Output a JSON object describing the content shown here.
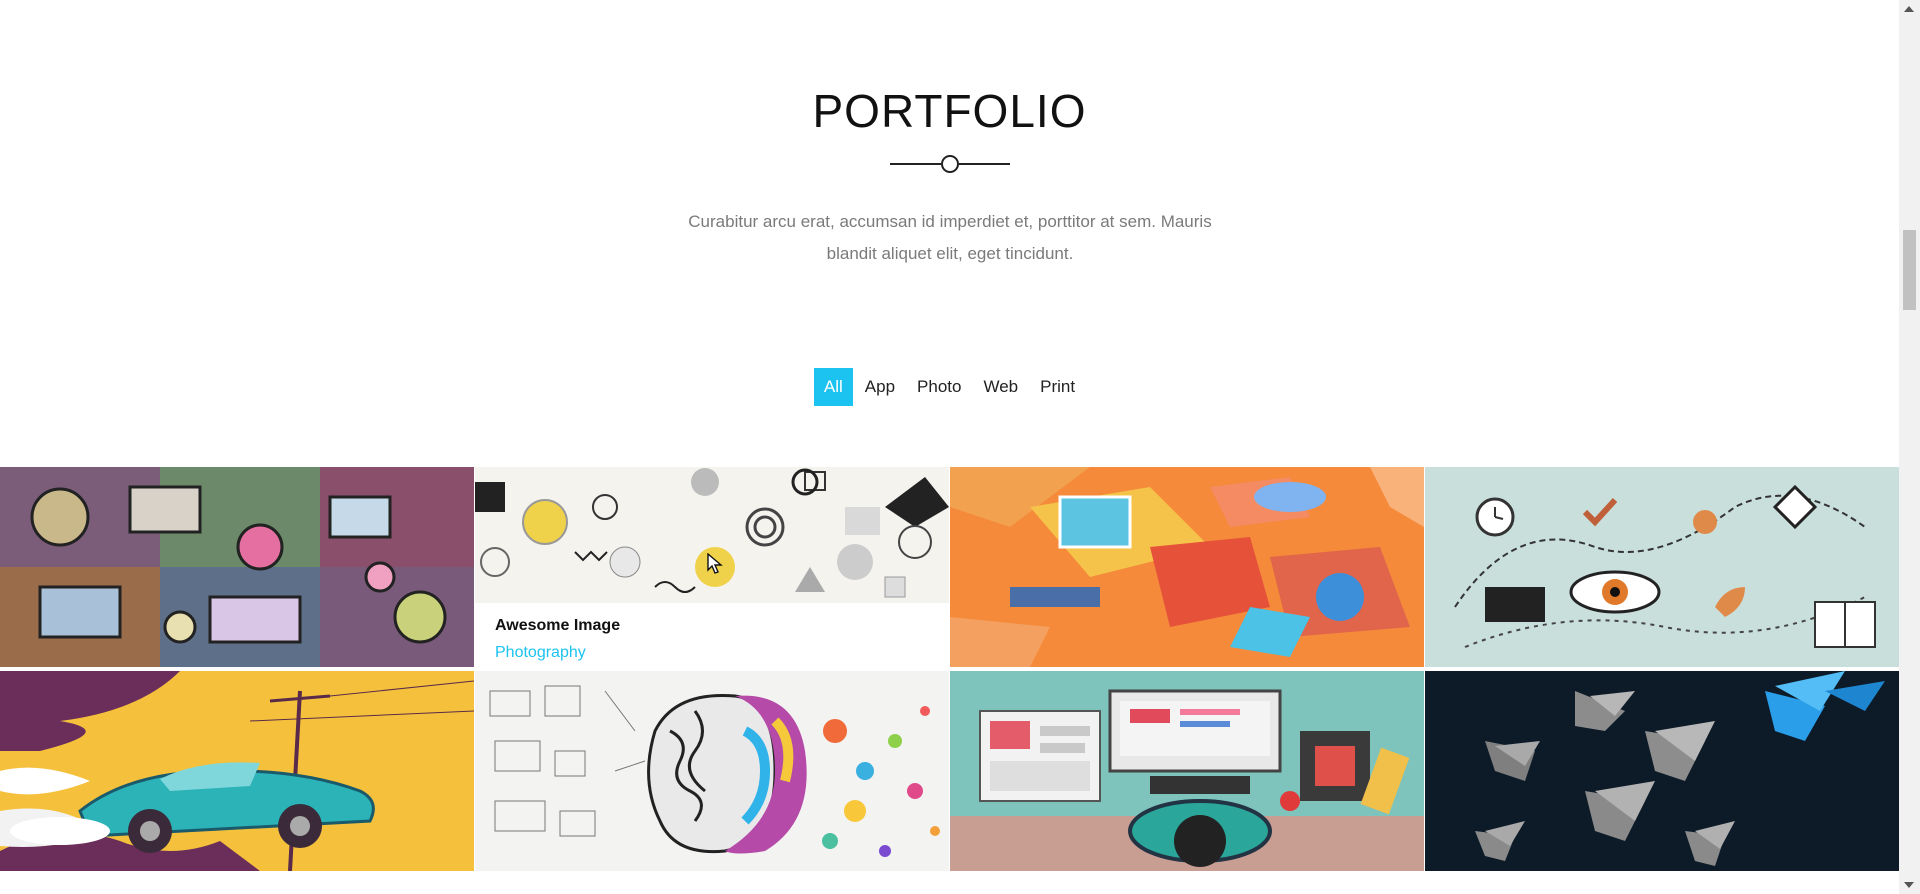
{
  "section": {
    "title": "PORTFOLIO",
    "subtitle": "Curabitur arcu erat, accumsan id imperdiet et, porttitor at sem. Mauris blandit aliquet elit, eget tincidunt."
  },
  "filters": [
    {
      "label": "All",
      "active": true
    },
    {
      "label": "App",
      "active": false
    },
    {
      "label": "Photo",
      "active": false
    },
    {
      "label": "Web",
      "active": false
    },
    {
      "label": "Print",
      "active": false
    }
  ],
  "hover_caption": {
    "title": "Awesome Image",
    "category": "Photography"
  },
  "tiles": [
    {
      "subject": "doodle-tech-collage"
    },
    {
      "subject": "geometric-pattern-shapes"
    },
    {
      "subject": "isometric-orange-illustration"
    },
    {
      "subject": "icon-flow-illustration"
    },
    {
      "subject": "retro-car-illustration"
    },
    {
      "subject": "colorful-brain-sketch"
    },
    {
      "subject": "workspace-desk-illustration"
    },
    {
      "subject": "origami-birds"
    }
  ],
  "colors": {
    "accent": "#1cc3f0",
    "text": "#111111",
    "muted": "#7a7a7a"
  }
}
